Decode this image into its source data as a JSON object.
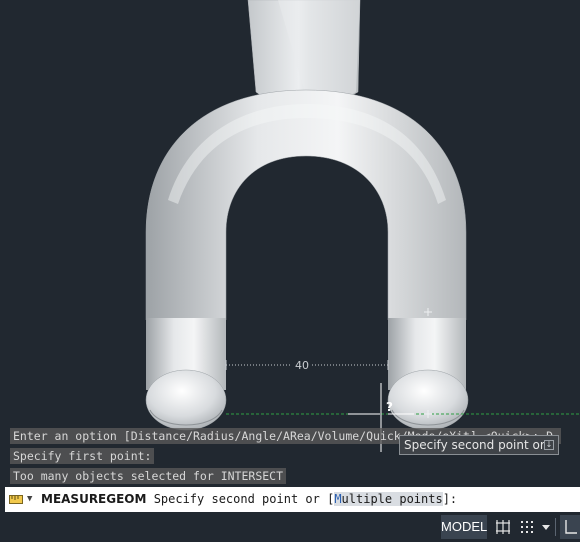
{
  "viewport": {
    "dimension_value": "40",
    "pickbox_glyph": "?"
  },
  "command_history": [
    "Enter an option [Distance/Radius/Angle/ARea/Volume/Quick/Mode/eXit] <Quick>: D",
    "Specify first point:",
    "Too many objects selected for INTERSECT"
  ],
  "tooltip": {
    "text": "Specify second point or",
    "expand_icon": "down-arrow-icon"
  },
  "command_line": {
    "icon": "measure-tool-icon",
    "command": "MEASUREGEOM",
    "prompt_before": "Specify second point or [",
    "option_key": "M",
    "option_rest": "ultiple points",
    "prompt_after": "]:"
  },
  "status_bar": {
    "model_label": "MODEL",
    "icons": [
      "grid-icon",
      "snap-icon",
      "chevron-down-icon",
      "ortho-icon"
    ]
  },
  "colors": {
    "background": "#212830",
    "alignment_guide": "#2ea043",
    "tooltip_bg": "#3f4348",
    "command_line_bg": "#ffffff"
  }
}
